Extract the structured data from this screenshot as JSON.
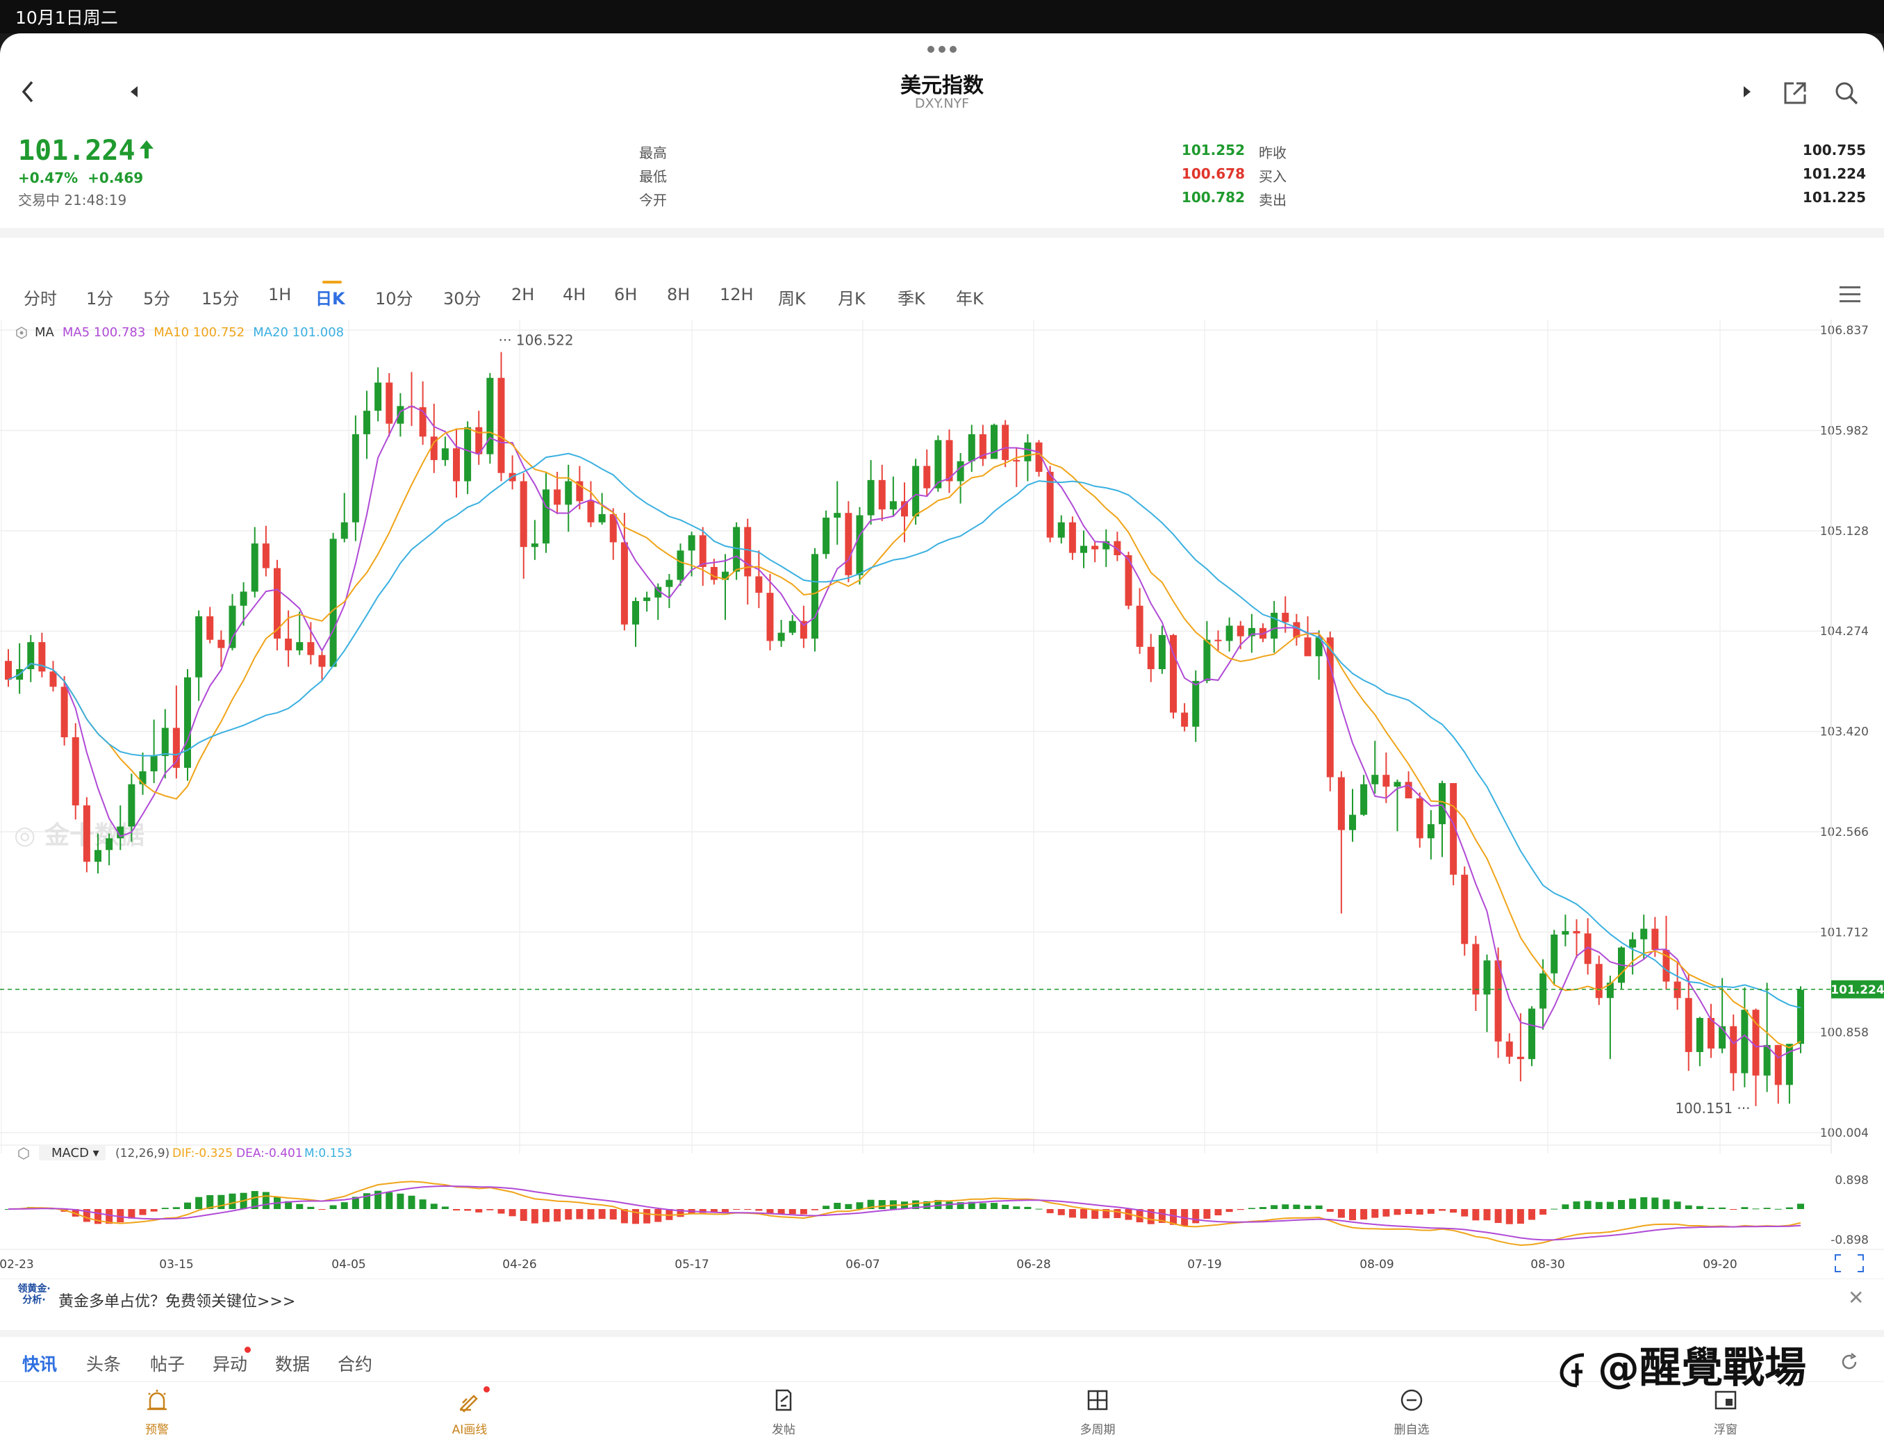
{
  "status_bar": {
    "datetime": "10月1日周二"
  },
  "header": {
    "title": "美元指数",
    "symbol": "DXY.NYF"
  },
  "quote": {
    "price": "101.224",
    "change_pct": "+0.47%",
    "change_abs": "+0.469",
    "status": "交易中 21:48:19",
    "stats": [
      {
        "label": "最高",
        "value": "101.252",
        "color": "#1f9a2e"
      },
      {
        "label": "最低",
        "value": "100.678",
        "color": "#e0352b"
      },
      {
        "label": "今开",
        "value": "100.782",
        "color": "#1f9a2e"
      }
    ],
    "stats_right": [
      {
        "label": "昨收",
        "value": "100.755"
      },
      {
        "label": "买入",
        "value": "101.224"
      },
      {
        "label": "卖出",
        "value": "101.225"
      }
    ]
  },
  "period_tabs": [
    "分时",
    "1分",
    "5分",
    "15分",
    "1H",
    "日K",
    "10分",
    "30分",
    "2H",
    "4H",
    "6H",
    "8H",
    "12H",
    "周K",
    "月K",
    "季K",
    "年K"
  ],
  "active_period": "日K",
  "ma_legend": {
    "name": "MA",
    "ma5": "MA5 100.783",
    "ma10": "MA10 100.752",
    "ma20": "MA20 101.008"
  },
  "colors": {
    "up": "#1f9a2e",
    "down": "#e8433b",
    "ma5": "#b04ad6",
    "ma10": "#f0a419",
    "ma20": "#3ab0e0"
  },
  "chart_data": {
    "type": "candlestick",
    "y_ticks": [
      "106.837",
      "105.982",
      "105.128",
      "104.274",
      "103.420",
      "102.566",
      "101.712",
      "100.858",
      "100.004"
    ],
    "ylim": [
      100.004,
      106.837
    ],
    "x_labels": [
      "02-23",
      "03-15",
      "04-05",
      "04-26",
      "05-17",
      "06-07",
      "06-28",
      "07-19",
      "08-09",
      "08-30",
      "09-20"
    ],
    "current_price_label": "101.224",
    "high_label": "106.522",
    "low_label": "100.151",
    "ohlc": [
      [
        104.02,
        104.12,
        103.8,
        103.86
      ],
      [
        103.86,
        104.17,
        103.74,
        103.95
      ],
      [
        103.95,
        104.24,
        103.84,
        104.18
      ],
      [
        104.18,
        104.26,
        103.88,
        103.93
      ],
      [
        103.93,
        104.02,
        103.76,
        103.8
      ],
      [
        103.8,
        103.89,
        103.3,
        103.37
      ],
      [
        103.37,
        103.49,
        102.67,
        102.79
      ],
      [
        102.79,
        102.86,
        102.22,
        102.31
      ],
      [
        102.31,
        102.55,
        102.21,
        102.41
      ],
      [
        102.41,
        102.55,
        102.28,
        102.51
      ],
      [
        102.51,
        102.79,
        102.41,
        102.61
      ],
      [
        102.61,
        103.06,
        102.48,
        102.97
      ],
      [
        102.97,
        103.24,
        102.88,
        103.08
      ],
      [
        103.08,
        103.52,
        102.98,
        103.21
      ],
      [
        103.21,
        103.61,
        103.02,
        103.45
      ],
      [
        103.45,
        103.81,
        103.02,
        103.11
      ],
      [
        103.11,
        103.95,
        103.0,
        103.88
      ],
      [
        103.88,
        104.45,
        103.68,
        104.4
      ],
      [
        104.4,
        104.48,
        104.17,
        104.2
      ],
      [
        104.2,
        104.28,
        103.97,
        104.13
      ],
      [
        104.13,
        104.59,
        104.11,
        104.49
      ],
      [
        104.49,
        104.69,
        104.32,
        104.61
      ],
      [
        104.61,
        105.16,
        104.56,
        105.02
      ],
      [
        105.02,
        105.17,
        104.74,
        104.81
      ],
      [
        104.81,
        104.88,
        104.11,
        104.21
      ],
      [
        104.21,
        104.45,
        103.97,
        104.11
      ],
      [
        104.11,
        104.44,
        104.07,
        104.18
      ],
      [
        104.18,
        104.35,
        103.99,
        104.07
      ],
      [
        104.07,
        104.1,
        103.86,
        103.97
      ],
      [
        103.97,
        105.11,
        103.97,
        105.06
      ],
      [
        105.06,
        105.45,
        105.03,
        105.2
      ],
      [
        105.2,
        106.11,
        105.04,
        105.95
      ],
      [
        105.95,
        106.32,
        105.74,
        106.15
      ],
      [
        106.15,
        106.52,
        106.06,
        106.39
      ],
      [
        106.39,
        106.47,
        105.93,
        106.04
      ],
      [
        106.04,
        106.3,
        105.93,
        106.19
      ],
      [
        106.19,
        106.48,
        106.02,
        106.18
      ],
      [
        106.18,
        106.4,
        105.86,
        105.93
      ],
      [
        105.93,
        106.21,
        105.62,
        105.73
      ],
      [
        105.73,
        105.93,
        105.68,
        105.83
      ],
      [
        105.83,
        105.99,
        105.41,
        105.55
      ],
      [
        105.55,
        106.06,
        105.44,
        106.01
      ],
      [
        106.01,
        106.15,
        105.69,
        105.78
      ],
      [
        105.78,
        106.47,
        105.7,
        106.43
      ],
      [
        106.43,
        106.65,
        105.55,
        105.62
      ],
      [
        105.62,
        105.77,
        105.48,
        105.55
      ],
      [
        105.55,
        105.62,
        104.72,
        104.99
      ],
      [
        104.99,
        105.22,
        104.88,
        105.02
      ],
      [
        105.02,
        105.62,
        104.94,
        105.48
      ],
      [
        105.48,
        105.63,
        105.27,
        105.35
      ],
      [
        105.35,
        105.69,
        105.12,
        105.55
      ],
      [
        105.55,
        105.68,
        105.31,
        105.38
      ],
      [
        105.38,
        105.55,
        105.16,
        105.2
      ],
      [
        105.2,
        105.45,
        105.18,
        105.27
      ],
      [
        105.27,
        105.32,
        104.88,
        105.03
      ],
      [
        105.03,
        105.28,
        104.28,
        104.33
      ],
      [
        104.33,
        104.56,
        104.14,
        104.53
      ],
      [
        104.53,
        104.61,
        104.44,
        104.56
      ],
      [
        104.56,
        104.68,
        104.37,
        104.65
      ],
      [
        104.65,
        104.76,
        104.47,
        104.71
      ],
      [
        104.71,
        105.02,
        104.66,
        104.96
      ],
      [
        104.96,
        105.12,
        104.74,
        105.09
      ],
      [
        105.09,
        105.16,
        104.66,
        104.82
      ],
      [
        104.82,
        104.89,
        104.67,
        104.71
      ],
      [
        104.71,
        104.93,
        104.37,
        104.78
      ],
      [
        104.78,
        105.2,
        104.71,
        105.16
      ],
      [
        105.16,
        105.23,
        104.5,
        104.74
      ],
      [
        104.74,
        104.96,
        104.47,
        104.6
      ],
      [
        104.6,
        104.76,
        104.11,
        104.19
      ],
      [
        104.19,
        104.37,
        104.14,
        104.26
      ],
      [
        104.26,
        104.41,
        104.24,
        104.36
      ],
      [
        104.36,
        104.49,
        104.13,
        104.21
      ],
      [
        104.21,
        104.98,
        104.1,
        104.93
      ],
      [
        104.93,
        105.3,
        104.89,
        105.24
      ],
      [
        105.24,
        105.55,
        105.01,
        105.28
      ],
      [
        105.28,
        105.38,
        104.69,
        104.75
      ],
      [
        104.75,
        105.33,
        104.67,
        105.26
      ],
      [
        105.26,
        105.73,
        105.18,
        105.56
      ],
      [
        105.56,
        105.69,
        105.21,
        105.31
      ],
      [
        105.31,
        105.59,
        105.25,
        105.38
      ],
      [
        105.38,
        105.54,
        105.03,
        105.25
      ],
      [
        105.25,
        105.74,
        105.18,
        105.68
      ],
      [
        105.68,
        105.82,
        105.42,
        105.49
      ],
      [
        105.49,
        105.94,
        105.46,
        105.9
      ],
      [
        105.9,
        105.99,
        105.45,
        105.55
      ],
      [
        105.55,
        105.79,
        105.36,
        105.72
      ],
      [
        105.72,
        106.03,
        105.63,
        105.95
      ],
      [
        105.95,
        106.03,
        105.68,
        105.74
      ],
      [
        105.74,
        106.04,
        105.74,
        106.03
      ],
      [
        106.03,
        106.07,
        105.67,
        105.73
      ],
      [
        105.73,
        105.84,
        105.5,
        105.72
      ],
      [
        105.72,
        105.95,
        105.55,
        105.88
      ],
      [
        105.88,
        105.9,
        105.59,
        105.63
      ],
      [
        105.63,
        105.68,
        105.03,
        105.07
      ],
      [
        105.07,
        105.26,
        105.02,
        105.2
      ],
      [
        105.2,
        105.25,
        104.88,
        104.94
      ],
      [
        104.94,
        105.13,
        104.81,
        105.0
      ],
      [
        105.0,
        105.04,
        104.86,
        104.97
      ],
      [
        104.97,
        105.14,
        104.82,
        105.04
      ],
      [
        105.04,
        105.12,
        104.87,
        104.92
      ],
      [
        104.92,
        104.95,
        104.46,
        104.49
      ],
      [
        104.49,
        104.64,
        104.08,
        104.14
      ],
      [
        104.14,
        104.25,
        103.84,
        103.95
      ],
      [
        103.95,
        104.32,
        103.91,
        104.24
      ],
      [
        104.24,
        104.25,
        103.53,
        103.58
      ],
      [
        103.58,
        103.66,
        103.42,
        103.46
      ],
      [
        103.46,
        103.94,
        103.33,
        103.85
      ],
      [
        103.85,
        104.36,
        103.83,
        104.2
      ],
      [
        104.2,
        104.28,
        104.1,
        104.19
      ],
      [
        104.19,
        104.39,
        104.1,
        104.32
      ],
      [
        104.32,
        104.36,
        104.12,
        104.23
      ],
      [
        104.23,
        104.42,
        104.09,
        104.3
      ],
      [
        104.3,
        104.34,
        104.18,
        104.21
      ],
      [
        104.21,
        104.53,
        104.09,
        104.43
      ],
      [
        104.43,
        104.57,
        104.26,
        104.35
      ],
      [
        104.35,
        104.42,
        104.15,
        104.22
      ],
      [
        104.22,
        104.4,
        104.08,
        104.06
      ],
      [
        104.06,
        104.28,
        103.86,
        104.22
      ],
      [
        104.22,
        104.27,
        102.91,
        103.03
      ],
      [
        103.03,
        103.08,
        101.87,
        102.58
      ],
      [
        102.58,
        102.93,
        102.48,
        102.71
      ],
      [
        102.71,
        103.05,
        102.7,
        102.97
      ],
      [
        102.97,
        103.34,
        102.89,
        103.05
      ],
      [
        103.05,
        103.24,
        102.81,
        102.95
      ],
      [
        102.95,
        103.01,
        102.57,
        102.99
      ],
      [
        102.99,
        103.08,
        102.85,
        102.85
      ],
      [
        102.85,
        102.9,
        102.43,
        102.51
      ],
      [
        102.51,
        102.75,
        102.33,
        102.63
      ],
      [
        102.63,
        103.0,
        102.35,
        102.98
      ],
      [
        102.98,
        102.98,
        102.11,
        102.2
      ],
      [
        102.2,
        102.27,
        101.51,
        101.61
      ],
      [
        101.61,
        101.68,
        101.04,
        101.18
      ],
      [
        101.18,
        101.52,
        100.86,
        101.47
      ],
      [
        101.47,
        101.58,
        100.64,
        100.78
      ],
      [
        100.78,
        100.85,
        100.59,
        100.65
      ],
      [
        100.65,
        101.02,
        100.44,
        100.63
      ],
      [
        100.63,
        101.08,
        100.57,
        101.06
      ],
      [
        101.06,
        101.48,
        100.88,
        101.36
      ],
      [
        101.36,
        101.73,
        101.26,
        101.69
      ],
      [
        101.69,
        101.86,
        101.59,
        101.72
      ],
      [
        101.72,
        101.82,
        101.49,
        101.7
      ],
      [
        101.7,
        101.83,
        101.35,
        101.44
      ],
      [
        101.44,
        101.51,
        101.09,
        101.15
      ],
      [
        101.15,
        101.34,
        100.63,
        101.28
      ],
      [
        101.28,
        101.59,
        101.22,
        101.58
      ],
      [
        101.58,
        101.71,
        101.35,
        101.65
      ],
      [
        101.65,
        101.86,
        101.48,
        101.74
      ],
      [
        101.74,
        101.84,
        101.5,
        101.56
      ],
      [
        101.56,
        101.85,
        101.22,
        101.29
      ],
      [
        101.29,
        101.46,
        101.05,
        101.15
      ],
      [
        101.15,
        101.35,
        100.53,
        100.69
      ],
      [
        100.69,
        100.99,
        100.57,
        100.98
      ],
      [
        100.98,
        101.1,
        100.64,
        100.72
      ],
      [
        100.72,
        101.32,
        100.68,
        100.91
      ],
      [
        100.91,
        101.01,
        100.36,
        100.51
      ],
      [
        100.51,
        101.24,
        100.39,
        101.05
      ],
      [
        101.05,
        101.06,
        100.23,
        100.49
      ],
      [
        100.49,
        101.28,
        100.35,
        100.75
      ],
      [
        100.75,
        100.75,
        100.25,
        100.41
      ],
      [
        100.41,
        100.76,
        100.25,
        100.76
      ],
      [
        100.76,
        101.25,
        100.68,
        101.22
      ]
    ],
    "macd": {
      "params": "(12,26,9)",
      "dif": "DIF:-0.325",
      "dea": "DEA:-0.401",
      "m": "M:0.153",
      "ylim_labels": [
        "0.898",
        "-0.898"
      ]
    }
  },
  "ad": {
    "logo_text": "领黄金·分析·",
    "text": "黄金多单占优？免费领关键位>>>"
  },
  "news_tabs": [
    "快讯",
    "头条",
    "帖子",
    "异动",
    "数据",
    "合约"
  ],
  "bottom_nav": [
    "预警",
    "AI画线",
    "发帖",
    "多周期",
    "删自选",
    "浮窗"
  ],
  "watermark": "@醒覺戰場",
  "faint_watermark": "金十数据"
}
